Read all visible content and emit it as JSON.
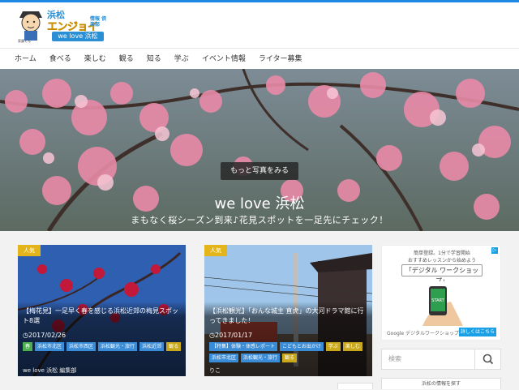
{
  "site": {
    "logo_top": "浜松",
    "logo_main": "エンジョイ",
    "logo_side": "情報 倶楽部",
    "logo_sub": "we love 浜松"
  },
  "nav": {
    "items": [
      "ホーム",
      "食べる",
      "楽しむ",
      "観る",
      "知る",
      "学ぶ",
      "イベント情報",
      "ライター募集"
    ]
  },
  "hero": {
    "title": "we love 浜松",
    "subtitle": "まもなく桜シーズン到来♪花見スポットを一足先にチェック！",
    "button": "もっと写真をみる"
  },
  "cards": [
    {
      "badge": "人気",
      "title": "【梅花見】一足早く春を感じる浜松近郊の梅見スポット8選",
      "date": "2017/02/26",
      "tags": [
        {
          "label": "春",
          "color": "green"
        },
        {
          "label": "浜松市北区",
          "color": "blue"
        },
        {
          "label": "浜松市西区",
          "color": "blue"
        },
        {
          "label": "浜松観光・旅行",
          "color": "blue"
        },
        {
          "label": "浜松近郊",
          "color": "blue"
        },
        {
          "label": "観る",
          "color": "yellow"
        }
      ],
      "author": "we love 浜松 編集部"
    },
    {
      "badge": "人気",
      "title": "【浜松観光】「おんな城主 直虎」の大河ドラマ館に行ってきました！",
      "date": "2017/01/17",
      "tags": [
        {
          "label": "【特集】体験・体感レポート",
          "color": "blue"
        },
        {
          "label": "こどもとお出かけ",
          "color": "blue"
        },
        {
          "label": "学ぶ",
          "color": "yellow"
        },
        {
          "label": "楽しむ",
          "color": "yellow"
        },
        {
          "label": "浜松市北区",
          "color": "blue"
        },
        {
          "label": "浜松観光・旅行",
          "color": "blue"
        },
        {
          "label": "観る",
          "color": "yellow"
        }
      ],
      "author": "りこ"
    }
  ],
  "ad": {
    "line1": "簡単登録。1分で学習開始",
    "line2": "おすすめレッスンから始めよう",
    "cta": "「デジタル ワークショップ」",
    "google": "Google デジタルワークショップ",
    "detail": "詳しくはこちら",
    "phone_text": "START"
  },
  "search": {
    "placeholder": "検索"
  },
  "sidebar": {
    "heading": "浜松の情報を探す"
  },
  "colors": {
    "accent": "#1e88e5",
    "badge": "#e3b51b",
    "tag_blue": "#3b8cd6",
    "tag_green": "#4caf50"
  }
}
